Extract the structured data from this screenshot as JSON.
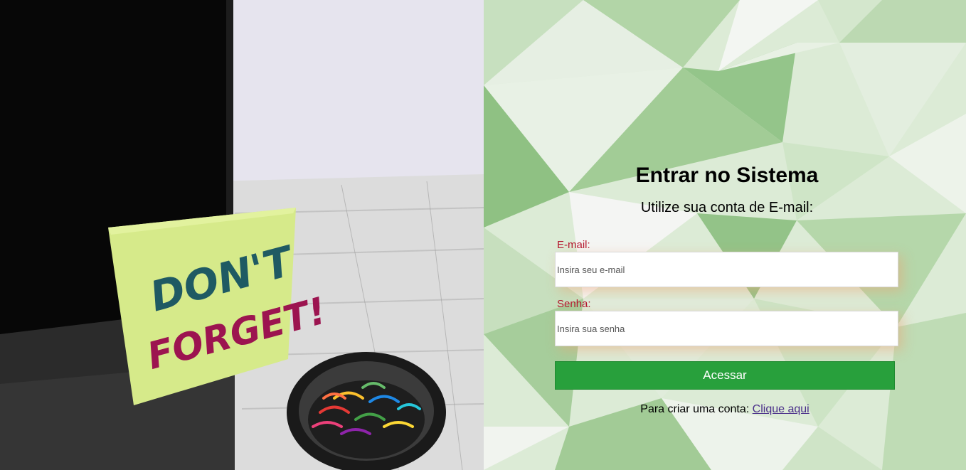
{
  "photo": {
    "sticky_note_line1": "DON'T",
    "sticky_note_line2": "FORGET!"
  },
  "login": {
    "title": "Entrar no Sistema",
    "subtitle": "Utilize sua conta de E-mail:",
    "email_label": "E-mail:",
    "email_placeholder": "Insira seu e-mail",
    "password_label": "Senha:",
    "password_placeholder": "Insira sua senha",
    "submit_label": "Acessar",
    "signup_prompt": "Para criar uma conta:",
    "signup_link": "Clique aqui"
  },
  "colors": {
    "accent": "#28a03c",
    "label": "#b4172e",
    "link": "#4a2f8a"
  }
}
